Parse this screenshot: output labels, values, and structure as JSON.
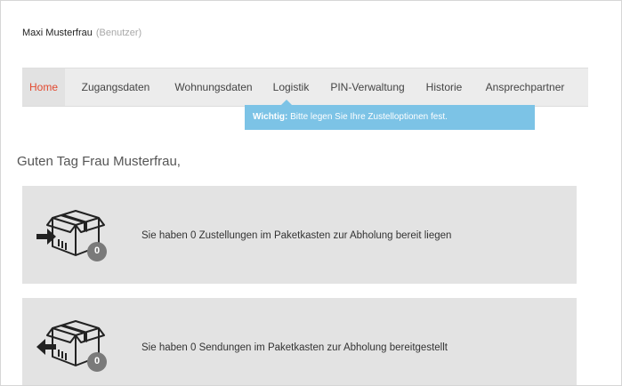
{
  "user": {
    "name": "Maxi Musterfrau",
    "role": "(Benutzer)"
  },
  "nav": {
    "items": [
      {
        "label": "Home"
      },
      {
        "label": "Zugangsdaten"
      },
      {
        "label": "Wohnungsdaten"
      },
      {
        "label": "Logistik"
      },
      {
        "label": "PIN-Verwaltung"
      },
      {
        "label": "Historie"
      },
      {
        "label": "Ansprechpartner"
      }
    ],
    "active": "Home"
  },
  "tooltip": {
    "strong": "Wichtig:",
    "text": "Bitte legen Sie Ihre Zustelloptionen fest."
  },
  "greeting": "Guten Tag Frau Musterfrau,",
  "cards": [
    {
      "text": "Sie haben 0 Zustellungen im Paketkasten zur Abholung bereit liegen",
      "count": "0",
      "icon": "package-incoming-icon"
    },
    {
      "text": "Sie haben 0 Sendungen im Paketkasten zur Abholung bereitgestellt",
      "count": "0",
      "icon": "package-outgoing-icon"
    }
  ],
  "colors": {
    "accent": "#e2492f",
    "info": "#7cc3e6",
    "card": "#e3e3e3",
    "badge": "#7a7a7a"
  }
}
